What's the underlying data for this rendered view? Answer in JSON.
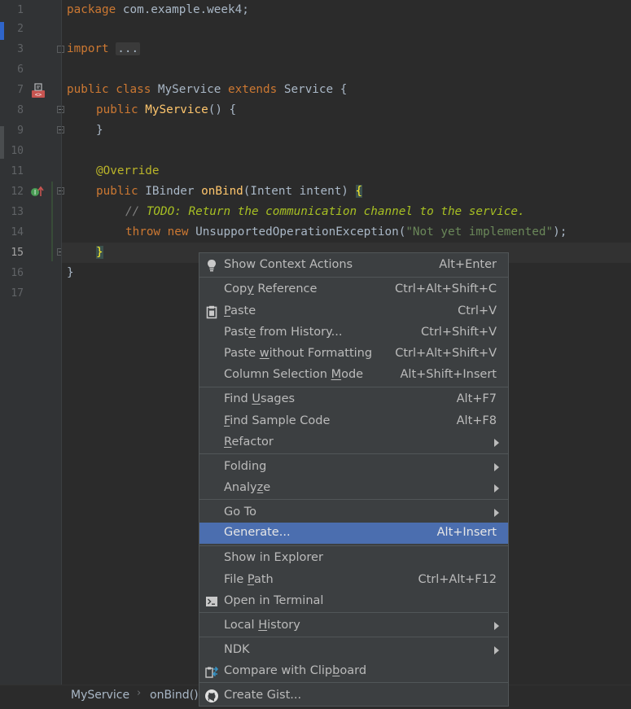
{
  "editor": {
    "line_numbers": [
      "1",
      "2",
      "3",
      "6",
      "7",
      "8",
      "9",
      "10",
      "11",
      "12",
      "13",
      "14",
      "15",
      "16",
      "17"
    ],
    "current_line": "15",
    "code": {
      "package_kw": "package",
      "package_name": " com.example.week4;",
      "import_kw": "import",
      "import_folded": "...",
      "l7_public": "public",
      "l7_class": "class",
      "l7_name": "MyService",
      "l7_extends": "extends",
      "l7_super": "Service {",
      "l8_public": "public",
      "l8_ctor": "MyService",
      "l8_rest": "() {",
      "l9_close": "}",
      "l11_annotation": "@Override",
      "l12_public": "public",
      "l12_type": "IBinder",
      "l12_method": "onBind",
      "l12_params": "(Intent intent) ",
      "l12_brace": "{",
      "l13_comment_prefix": "// ",
      "l13_todo": "TODO: Return the communication channel to the service.",
      "l14_throw": "throw",
      "l14_new": "new",
      "l14_exc": "UnsupportedOperationException(",
      "l14_string": "\"Not yet implemented\"",
      "l14_end": ");",
      "l15_brace": "}",
      "l16_close": "}"
    }
  },
  "breadcrumb": {
    "class_name": "MyService",
    "method_name": "onBind()"
  },
  "context_menu": {
    "items": [
      {
        "label": "Show Context Actions",
        "shortcut": "Alt+Enter",
        "icon": "lightbulb-icon"
      },
      {
        "label_pre": "Cop",
        "label_ul": "y",
        "label_post": " Reference",
        "shortcut": "Ctrl+Alt+Shift+C"
      },
      {
        "label_pre": "",
        "label_ul": "P",
        "label_post": "aste",
        "shortcut": "Ctrl+V",
        "icon": "clipboard-icon"
      },
      {
        "label_pre": "Past",
        "label_ul": "e",
        "label_post": " from History...",
        "shortcut": "Ctrl+Shift+V"
      },
      {
        "label_pre": "Paste ",
        "label_ul": "w",
        "label_post": "ithout Formatting",
        "shortcut": "Ctrl+Alt+Shift+V"
      },
      {
        "label_pre": "Column Selection ",
        "label_ul": "M",
        "label_post": "ode",
        "shortcut": "Alt+Shift+Insert"
      },
      {
        "label_pre": "Find ",
        "label_ul": "U",
        "label_post": "sages",
        "shortcut": "Alt+F7"
      },
      {
        "label_pre": "",
        "label_ul": "F",
        "label_post": "ind Sample Code",
        "shortcut": "Alt+F8"
      },
      {
        "label_pre": "",
        "label_ul": "R",
        "label_post": "efactor",
        "submenu": true
      },
      {
        "label_pre": "Folding",
        "label_ul": "",
        "label_post": "",
        "submenu": true
      },
      {
        "label_pre": "Analy",
        "label_ul": "z",
        "label_post": "e",
        "submenu": true
      },
      {
        "label_pre": "Go To",
        "label_ul": "",
        "label_post": "",
        "submenu": true
      },
      {
        "label": "Generate...",
        "shortcut": "Alt+Insert",
        "selected": true
      },
      {
        "label": "Show in Explorer"
      },
      {
        "label_pre": "File ",
        "label_ul": "P",
        "label_post": "ath",
        "shortcut": "Ctrl+Alt+F12"
      },
      {
        "label": "Open in Terminal",
        "icon": "terminal-icon"
      },
      {
        "label_pre": "Local ",
        "label_ul": "H",
        "label_post": "istory",
        "submenu": true
      },
      {
        "label": "NDK",
        "submenu": true
      },
      {
        "label_pre": "Compare with Clip",
        "label_ul": "b",
        "label_post": "oard",
        "icon": "compare-icon"
      },
      {
        "label": "Create Gist...",
        "icon": "github-icon"
      }
    ]
  },
  "colors": {
    "background": "#2b2b2b",
    "menu_bg": "#3c3f41",
    "selected": "#4b6eaf"
  }
}
